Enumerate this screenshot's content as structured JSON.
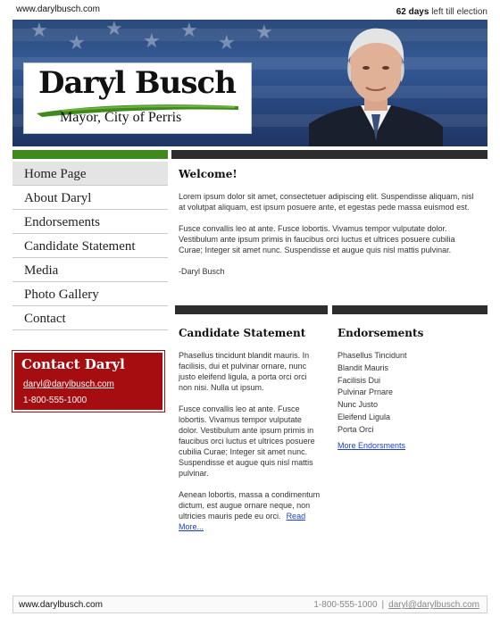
{
  "top": {
    "site_url": "www.darylbusch.com",
    "countdown_days": "62 days",
    "countdown_suffix": "left till election"
  },
  "banner": {
    "name": "Daryl Busch",
    "subtitle": "Mayor, City of Perris",
    "colors": {
      "flag_blue": "#2b4a7c",
      "swoosh_green": "#3f8a1e"
    }
  },
  "nav": {
    "items": [
      {
        "label": "Home Page"
      },
      {
        "label": "About Daryl"
      },
      {
        "label": "Endorsements"
      },
      {
        "label": "Candidate Statement"
      },
      {
        "label": "Media"
      },
      {
        "label": "Photo Gallery"
      },
      {
        "label": "Contact"
      }
    ]
  },
  "contact": {
    "title": "Contact Daryl",
    "email": "daryl@darylbusch.com",
    "phone": "1-800-555-1000",
    "color": "#a50d11"
  },
  "welcome": {
    "heading": "Welcome!",
    "p1": "Lorem ipsum dolor sit amet, consectetuer adipiscing elit. Suspendisse aliquam, nisl at volutpat aliquam, est ipsum posuere ante, et egestas pede massa euismod est.",
    "p2": "Fusce convallis leo at ante. Fusce lobortis. Vivamus tempor vulputate dolor. Vestibulum ante ipsum primis in faucibus orci luctus et ultrices posuere cubilia Curae; Integer sit amet nunc. Suspendisse et augue quis nisl mattis pulvinar.",
    "signature": "-Daryl Busch"
  },
  "candidate_statement": {
    "heading": "Candidate Statement",
    "p1": "Phasellus tincidunt blandit mauris. In facilisis, dui et pulvinar ornare, nunc justo eleifend ligula, a porta orci orci non nisi. Nulla ut ipsum.",
    "p2": "Fusce convallis leo at ante. Fusce lobortis. Vivamus tempor vulputate dolor. Vestibulum ante ipsum primis in faucibus orci luctus et ultrices posuere cubilia Curae; Integer sit amet nunc. Suspendisse et augue quis nisl mattis pulvinar.",
    "p3": "Aenean lobortis, massa a condimentum dictum, est augue ornare neque, non ultricies mauris pede eu orci.",
    "read_more": "Read More..."
  },
  "endorsements": {
    "heading": "Endorsements",
    "items": [
      "Phasellus Tincidunt",
      "Blandit Mauris",
      "Facilisis Dui",
      "Pulvinar Prnare",
      "Nunc Justo",
      "Eleifend Ligula",
      "Porta Orci"
    ],
    "more": "More Endorsments"
  },
  "footer": {
    "site_url": "www.darylbusch.com",
    "phone": "1-800-555-1000",
    "separator": "|",
    "email": "daryl@darylbusch.com"
  }
}
